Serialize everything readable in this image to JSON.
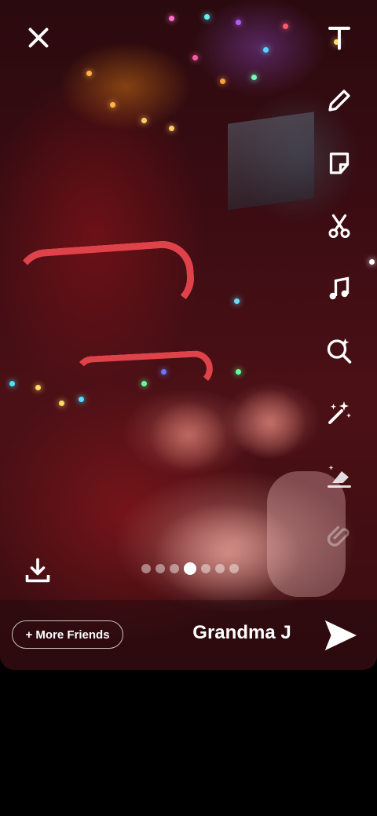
{
  "top_bar": {
    "close_icon": "close-icon"
  },
  "tools": [
    {
      "name": "text-tool",
      "icon": "text-icon"
    },
    {
      "name": "draw-tool",
      "icon": "pencil-icon"
    },
    {
      "name": "sticker-tool",
      "icon": "sticker-icon"
    },
    {
      "name": "scissors-tool",
      "icon": "scissors-icon"
    },
    {
      "name": "music-tool",
      "icon": "music-note-icon"
    },
    {
      "name": "lens-tool",
      "icon": "lens-search-icon"
    },
    {
      "name": "magic-tool",
      "icon": "magic-wand-icon"
    },
    {
      "name": "eraser-tool",
      "icon": "eraser-icon"
    },
    {
      "name": "link-tool",
      "icon": "paperclip-icon"
    }
  ],
  "download_icon": "download-icon",
  "pagination": {
    "count": 7,
    "active": 3
  },
  "bottom": {
    "more_friends_label": "+ More Friends",
    "recipient": "Grandma J",
    "send_icon": "send-arrow-icon"
  }
}
